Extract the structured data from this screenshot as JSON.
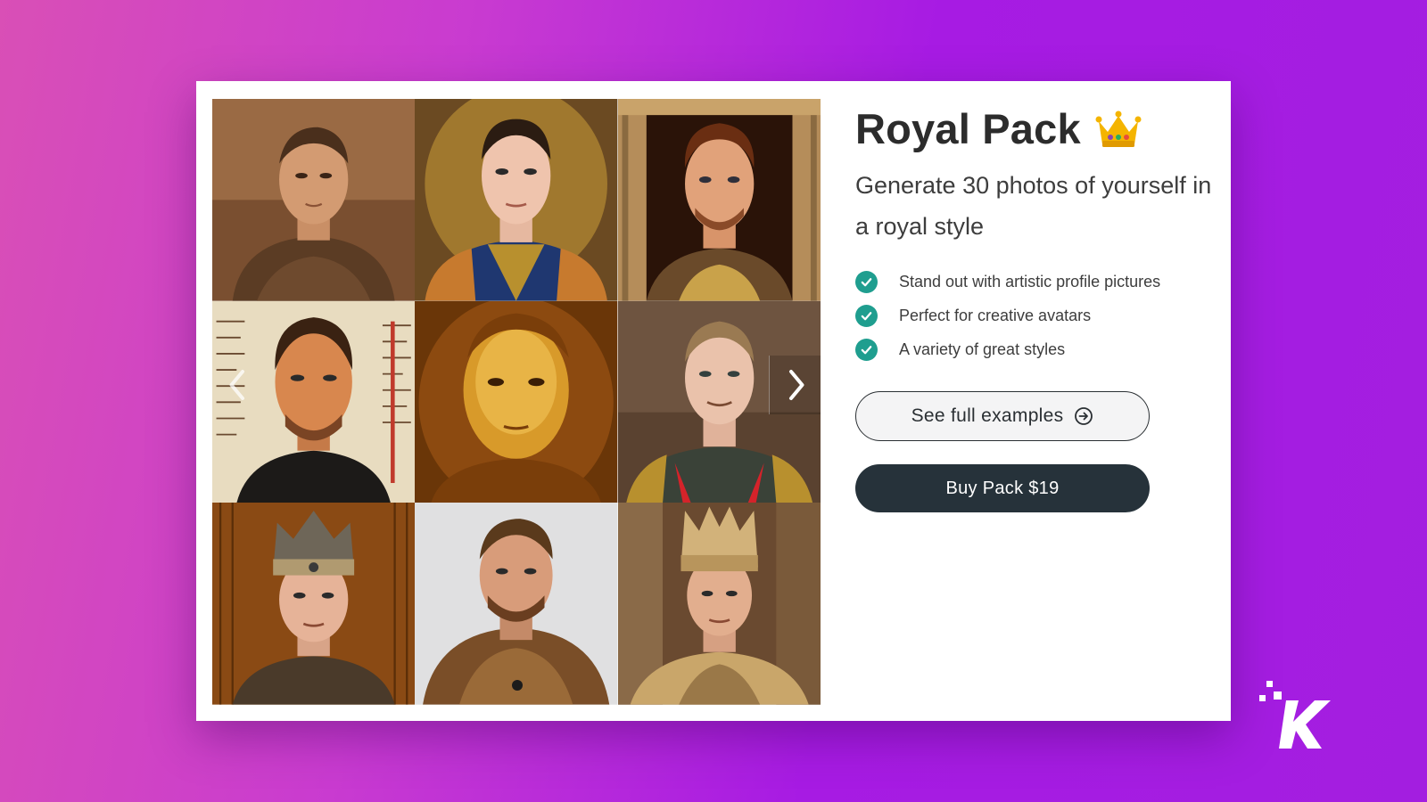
{
  "pack": {
    "title": "Royal Pack",
    "title_emoji": "crown-icon",
    "subtitle": "Generate 30 photos of yourself in a royal style",
    "features": [
      "Stand out with artistic profile pictures",
      "Perfect for creative avatars",
      "A variety of great styles"
    ],
    "see_examples_label": "See full examples",
    "buy_label": "Buy Pack $19"
  },
  "gallery": {
    "portraits": [
      "royal-portrait-armor",
      "royal-portrait-uniform",
      "royal-portrait-columns",
      "royal-portrait-manuscript",
      "royal-portrait-gold-painting",
      "royal-portrait-general",
      "royal-portrait-crown",
      "royal-portrait-knight",
      "royal-portrait-ancient-crown"
    ],
    "prev_icon": "chevron-left-icon",
    "next_icon": "chevron-right-icon"
  },
  "colors": {
    "check": "#1f9e8f",
    "buy_button": "#26323a",
    "background_start": "#d94fb6",
    "background_end": "#a31ee0"
  }
}
